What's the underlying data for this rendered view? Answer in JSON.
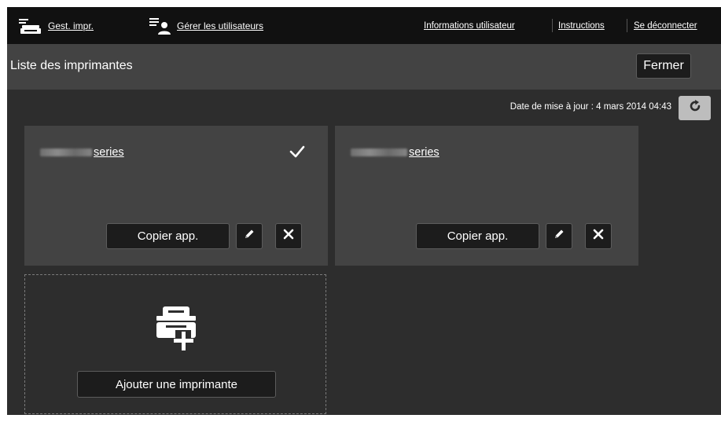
{
  "topnav": {
    "manage_printer": "Gest. impr.",
    "manage_users": "Gérer les utilisateurs",
    "user_info": "Informations utilisateur",
    "instructions": "Instructions",
    "logout": "Se déconnecter"
  },
  "header": {
    "title": "Liste des imprimantes",
    "close_label": "Fermer"
  },
  "update_text": "Date de mise à jour : 4 mars 2014 04:43",
  "printers": [
    {
      "name_suffix": "series",
      "selected": true,
      "copy_label": "Copier app."
    },
    {
      "name_suffix": "series",
      "selected": false,
      "copy_label": "Copier app."
    }
  ],
  "add_printer_label": "Ajouter une imprimante",
  "icons": [
    "printer-manage-icon",
    "users-manage-icon",
    "refresh-icon",
    "checkmark-icon",
    "pencil-icon",
    "close-x-icon",
    "add-printer-icon"
  ]
}
